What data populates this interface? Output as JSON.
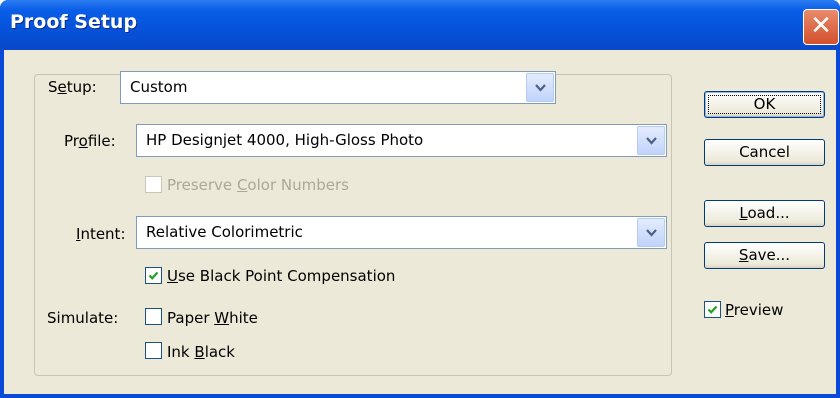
{
  "window": {
    "title": "Proof Setup",
    "close_glyph": "✕"
  },
  "setup": {
    "label_pre": "S",
    "label_u": "e",
    "label_post": "tup:",
    "value": "Custom"
  },
  "profile": {
    "label_pre": "Pr",
    "label_u": "o",
    "label_post": "file:",
    "value": "HP Designjet 4000, High-Gloss Photo"
  },
  "preserve": {
    "label_pre": "Preserve ",
    "label_u": "C",
    "label_post": "olor Numbers",
    "checked": false,
    "disabled": true
  },
  "intent": {
    "label_pre": "",
    "label_u": "I",
    "label_post": "ntent:",
    "value": "Relative Colorimetric"
  },
  "black_point": {
    "label_pre": "",
    "label_u": "U",
    "label_post": "se Black Point Compensation",
    "checked": true
  },
  "simulate": {
    "label": "Simulate:",
    "paper_white": {
      "label_pre": "Paper ",
      "label_u": "W",
      "label_post": "hite",
      "checked": false
    },
    "ink_black": {
      "label_pre": "Ink ",
      "label_u": "B",
      "label_post": "lack",
      "checked": false
    }
  },
  "buttons": {
    "ok": "OK",
    "cancel": "Cancel",
    "load_u": "L",
    "load_post": "oad...",
    "save_u": "S",
    "save_post": "ave..."
  },
  "preview": {
    "label_pre": "",
    "label_u": "P",
    "label_post": "review",
    "checked": true
  },
  "colors": {
    "titlebar": "#0652d9",
    "dialog_bg": "#ece9d8",
    "close": "#d3502c",
    "check": "#21a121"
  }
}
